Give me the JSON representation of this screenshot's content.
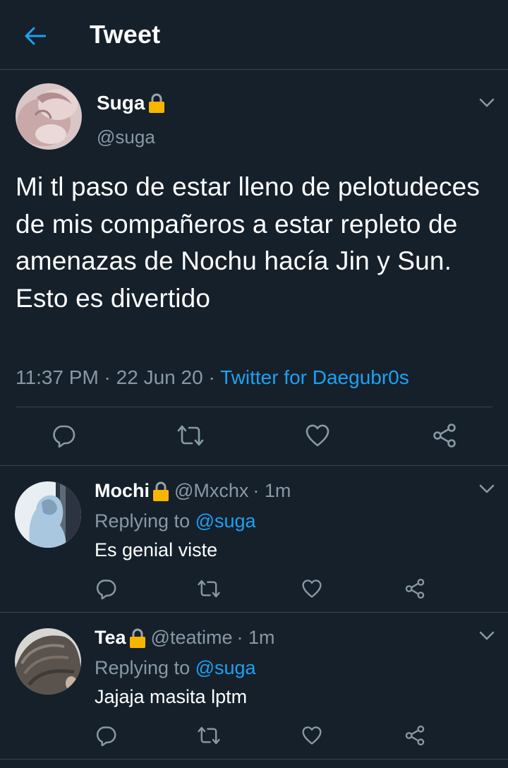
{
  "header": {
    "title": "Tweet",
    "back_icon": "arrow-left-icon"
  },
  "colors": {
    "background": "#15202b",
    "accent": "#1da1f2",
    "muted": "#8899a6",
    "divider": "#38444d",
    "lock": "#f7b500"
  },
  "main_tweet": {
    "name": "Suga",
    "handle": "@suga",
    "text": "Mi tl paso de estar lleno de pelotudeces de mis compañeros a estar repleto de amenazas de Nochu hacía Jin y Sun. Esto es divertido",
    "time": "11:37 PM",
    "separator": " · ",
    "date": "22 Jun 20",
    "source": "Twitter for Daegubr0s"
  },
  "replies": [
    {
      "name": "Mochi",
      "handle": "@Mxchx",
      "age": "· 1m",
      "replying_prefix": "Replying to ",
      "mention": "@suga",
      "text": "Es genial viste"
    },
    {
      "name": "Tea",
      "handle": "@teatime",
      "age": "· 1m",
      "replying_prefix": "Replying to ",
      "mention": "@suga",
      "text": "Jajaja masita lptm"
    }
  ]
}
